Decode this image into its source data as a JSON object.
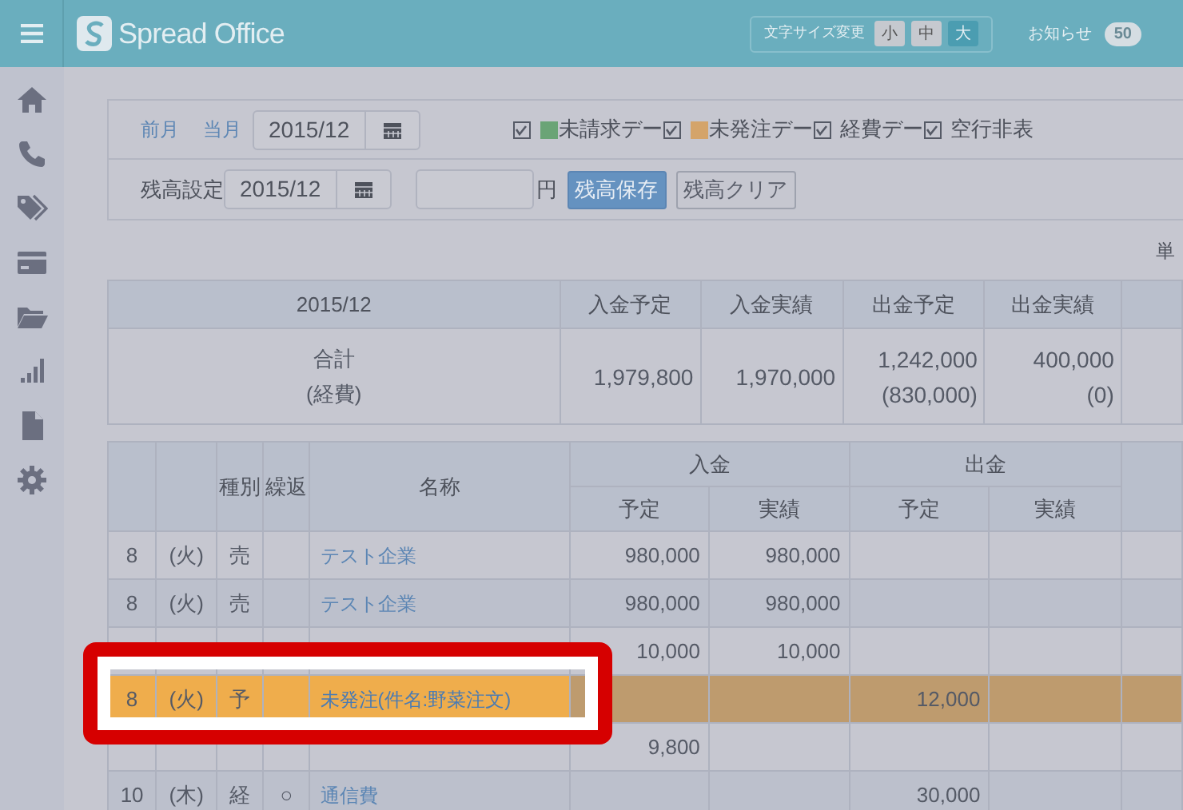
{
  "header": {
    "logo": "Spread Office",
    "font_size": {
      "label": "文字サイズ変更",
      "options": [
        {
          "label": "小",
          "selected": false
        },
        {
          "label": "中",
          "selected": false
        },
        {
          "label": "大",
          "selected": true
        }
      ]
    },
    "notice": {
      "label": "お知らせ",
      "count": "50"
    }
  },
  "filter": {
    "links": [
      "前月",
      "当月"
    ],
    "month": "2015/12",
    "options": [
      {
        "label": "未請求デー",
        "color": "#6aa476",
        "checked": true
      },
      {
        "label": "未発注デー",
        "color": "#d4a46a",
        "checked": true
      },
      {
        "label": "経費デー",
        "checked": true
      },
      {
        "label": "空行非表",
        "checked": true
      }
    ]
  },
  "balance": {
    "label": "残高設定",
    "month": "2015/12",
    "unit": "円",
    "buttons": [
      {
        "label": "残高保存",
        "kind": "primary"
      },
      {
        "label": "残高クリア",
        "kind": "default"
      }
    ]
  },
  "unit_note": "単",
  "summary": {
    "columns": [
      "2015/12",
      "入金予定",
      "入金実績",
      "出金予定",
      "出金実績"
    ],
    "cells": [
      [
        "合計",
        "(経費)"
      ],
      [
        "1,979,800"
      ],
      [
        "1,970,000"
      ],
      [
        "1,242,000",
        "(830,000)"
      ],
      [
        "400,000",
        "(0)"
      ]
    ]
  },
  "ledger": {
    "columns": [
      "種別",
      "繰返",
      "名称"
    ],
    "groups": [
      {
        "label": "入金",
        "columns": [
          "予定",
          "実績"
        ]
      },
      {
        "label": "出金",
        "columns": [
          "予定",
          "実績"
        ]
      }
    ],
    "rows": [
      {
        "day": "8",
        "weekday": "(火)",
        "type": "売",
        "name": "テスト企業",
        "in_plan": "980,000",
        "in_actual": "980,000",
        "highlighted": false
      },
      {
        "day": "8",
        "weekday": "(火)",
        "type": "売",
        "name": "テスト企業",
        "in_plan": "980,000",
        "in_actual": "980,000",
        "highlighted": false
      },
      {
        "in_plan": "10,000",
        "in_actual": "10,000",
        "highlighted": false
      },
      {
        "day": "8",
        "weekday": "(火)",
        "type": "予",
        "name": "未発注(件名:野菜注文)",
        "out_plan": "12,000",
        "highlighted": true
      },
      {
        "in_plan": "9,800",
        "highlighted": false
      },
      {
        "day": "10",
        "weekday": "(木)",
        "type": "経",
        "repeat": "○",
        "name": "通信費",
        "out_plan": "30,000",
        "highlighted": false
      }
    ]
  }
}
